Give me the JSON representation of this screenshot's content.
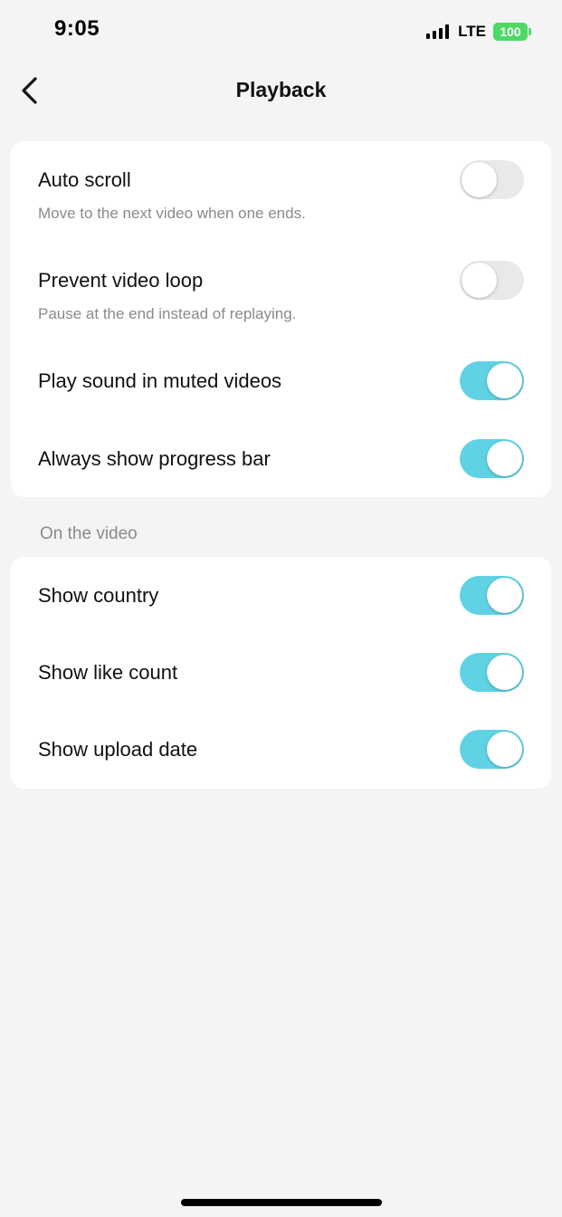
{
  "status_bar": {
    "time": "9:05",
    "network": "LTE",
    "battery": "100",
    "battery_color": "#4cd964"
  },
  "nav": {
    "title": "Playback",
    "back_icon": "chevron-left-icon"
  },
  "playback_settings": [
    {
      "label": "Auto scroll",
      "description": "Move to the next video when one ends.",
      "enabled": false
    },
    {
      "label": "Prevent video loop",
      "description": "Pause at the end instead of replaying.",
      "enabled": false
    },
    {
      "label": "Play sound in muted videos",
      "enabled": true
    },
    {
      "label": "Always show progress bar",
      "enabled": true
    }
  ],
  "video_section": {
    "header": "On the video",
    "items": [
      {
        "label": "Show country",
        "enabled": true
      },
      {
        "label": "Show like count",
        "enabled": true
      },
      {
        "label": "Show upload date",
        "enabled": true
      }
    ]
  },
  "colors": {
    "toggle_on": "#5fd3e4",
    "toggle_off": "#e9e9e9",
    "background": "#f4f4f4"
  }
}
